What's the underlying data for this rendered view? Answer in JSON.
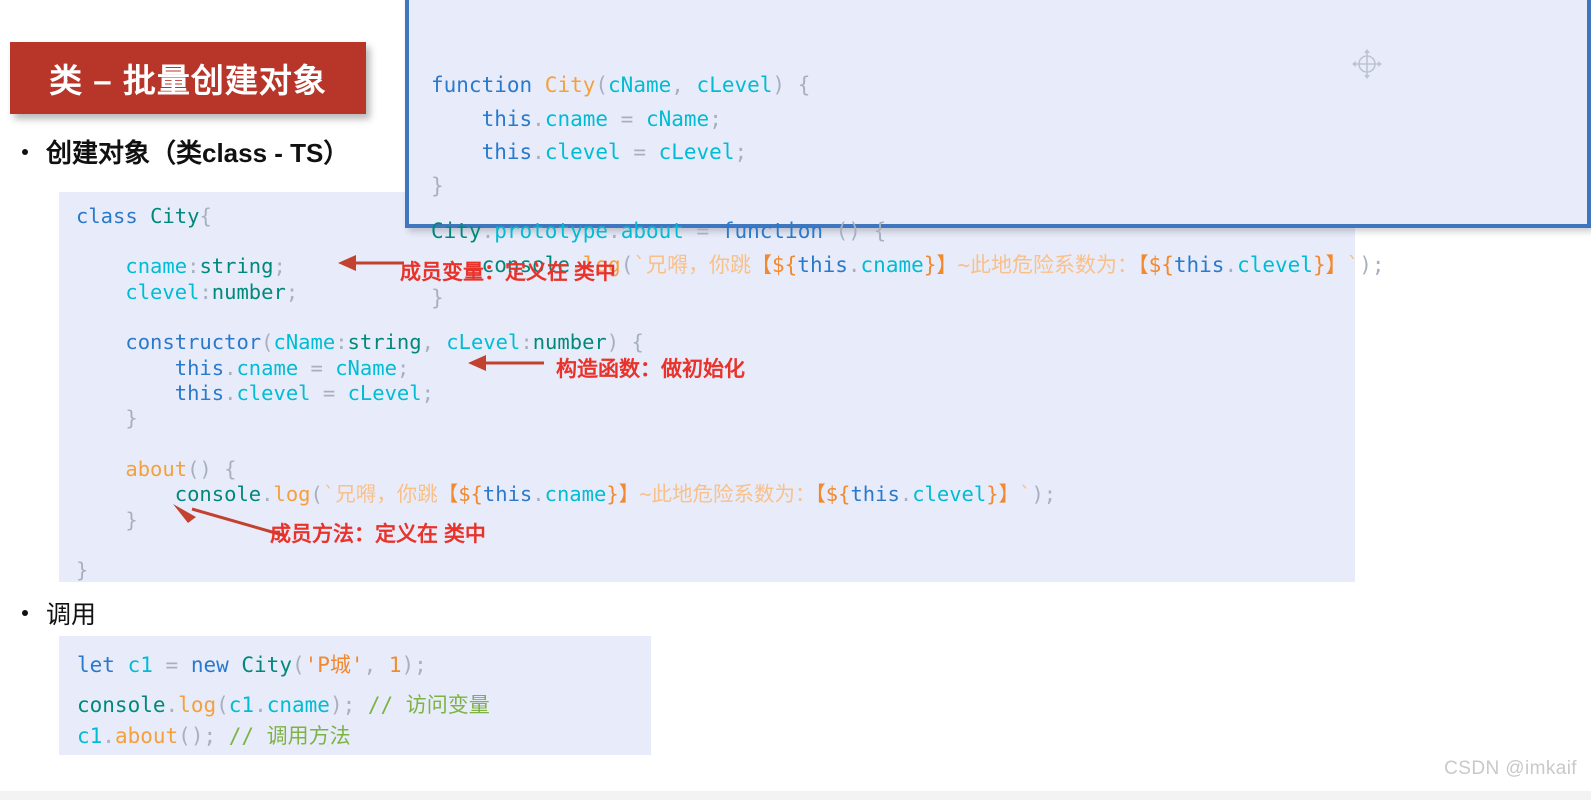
{
  "slide": {
    "title": "类 – 批量创建对象",
    "title_bg": "#B8352A",
    "watermark": "CSDN @imkaif"
  },
  "bullets": {
    "create": "创建对象（类class - TS）",
    "invoke": "调用"
  },
  "code_proto": {
    "lines": [
      [
        {
          "t": "function ",
          "c": "kw"
        },
        {
          "t": "City",
          "c": "fn"
        },
        {
          "t": "(",
          "c": "punct"
        },
        {
          "t": "cName",
          "c": "prop"
        },
        {
          "t": ", ",
          "c": "punct"
        },
        {
          "t": "cLevel",
          "c": "prop"
        },
        {
          "t": ") {",
          "c": "punct"
        }
      ],
      [
        {
          "t": "    ",
          "c": "plain"
        },
        {
          "t": "this",
          "c": "kw"
        },
        {
          "t": ".",
          "c": "punct"
        },
        {
          "t": "cname",
          "c": "prop"
        },
        {
          "t": " = ",
          "c": "punct"
        },
        {
          "t": "cName",
          "c": "prop"
        },
        {
          "t": ";",
          "c": "punct"
        }
      ],
      [
        {
          "t": "    ",
          "c": "plain"
        },
        {
          "t": "this",
          "c": "kw"
        },
        {
          "t": ".",
          "c": "punct"
        },
        {
          "t": "clevel",
          "c": "prop"
        },
        {
          "t": " = ",
          "c": "punct"
        },
        {
          "t": "cLevel",
          "c": "prop"
        },
        {
          "t": ";",
          "c": "punct"
        }
      ],
      [
        {
          "t": "}",
          "c": "punct"
        }
      ],
      [],
      [
        {
          "t": "City",
          "c": "type"
        },
        {
          "t": ".",
          "c": "punct"
        },
        {
          "t": "prototype",
          "c": "prop"
        },
        {
          "t": ".",
          "c": "punct"
        },
        {
          "t": "about",
          "c": "prop"
        },
        {
          "t": " = ",
          "c": "punct"
        },
        {
          "t": "function",
          "c": "kw"
        },
        {
          "t": " () {",
          "c": "punct"
        }
      ],
      [
        {
          "t": "    ",
          "c": "plain"
        },
        {
          "t": "console",
          "c": "type"
        },
        {
          "t": ".",
          "c": "punct"
        },
        {
          "t": "log",
          "c": "fn"
        },
        {
          "t": "(",
          "c": "punct"
        },
        {
          "t": "`兄嘚，你跳",
          "c": "str"
        },
        {
          "t": "【",
          "c": "strong"
        },
        {
          "t": "${",
          "c": "strong"
        },
        {
          "t": "this",
          "c": "kw"
        },
        {
          "t": ".",
          "c": "punct"
        },
        {
          "t": "cname",
          "c": "prop"
        },
        {
          "t": "}",
          "c": "strong"
        },
        {
          "t": "】",
          "c": "strong"
        },
        {
          "t": "~此地危险系数为：",
          "c": "str"
        },
        {
          "t": "【",
          "c": "strong"
        },
        {
          "t": "${",
          "c": "strong"
        },
        {
          "t": "this",
          "c": "kw"
        },
        {
          "t": ".",
          "c": "punct"
        },
        {
          "t": "clevel",
          "c": "prop"
        },
        {
          "t": "}",
          "c": "strong"
        },
        {
          "t": "】",
          "c": "strong"
        },
        {
          "t": "`",
          "c": "str"
        },
        {
          "t": ");",
          "c": "punct"
        }
      ],
      [
        {
          "t": "}",
          "c": "punct"
        }
      ]
    ]
  },
  "code_main": {
    "lines": [
      [
        {
          "t": "class ",
          "c": "kw"
        },
        {
          "t": "City",
          "c": "type"
        },
        {
          "t": "{",
          "c": "punct"
        }
      ],
      [],
      [
        {
          "t": "    ",
          "c": "plain"
        },
        {
          "t": "cname",
          "c": "prop"
        },
        {
          "t": ":",
          "c": "punct"
        },
        {
          "t": "string",
          "c": "type"
        },
        {
          "t": ";",
          "c": "punct"
        }
      ],
      [
        {
          "t": "    ",
          "c": "plain"
        },
        {
          "t": "clevel",
          "c": "prop"
        },
        {
          "t": ":",
          "c": "punct"
        },
        {
          "t": "number",
          "c": "type"
        },
        {
          "t": ";",
          "c": "punct"
        }
      ],
      [],
      [
        {
          "t": "    ",
          "c": "plain"
        },
        {
          "t": "constructor",
          "c": "kw"
        },
        {
          "t": "(",
          "c": "punct"
        },
        {
          "t": "cName",
          "c": "prop"
        },
        {
          "t": ":",
          "c": "punct"
        },
        {
          "t": "string",
          "c": "type"
        },
        {
          "t": ", ",
          "c": "punct"
        },
        {
          "t": "cLevel",
          "c": "prop"
        },
        {
          "t": ":",
          "c": "punct"
        },
        {
          "t": "number",
          "c": "type"
        },
        {
          "t": ") {",
          "c": "punct"
        }
      ],
      [
        {
          "t": "        ",
          "c": "plain"
        },
        {
          "t": "this",
          "c": "kw"
        },
        {
          "t": ".",
          "c": "punct"
        },
        {
          "t": "cname",
          "c": "prop"
        },
        {
          "t": " = ",
          "c": "punct"
        },
        {
          "t": "cName",
          "c": "prop"
        },
        {
          "t": ";",
          "c": "punct"
        }
      ],
      [
        {
          "t": "        ",
          "c": "plain"
        },
        {
          "t": "this",
          "c": "kw"
        },
        {
          "t": ".",
          "c": "punct"
        },
        {
          "t": "clevel",
          "c": "prop"
        },
        {
          "t": " = ",
          "c": "punct"
        },
        {
          "t": "cLevel",
          "c": "prop"
        },
        {
          "t": ";",
          "c": "punct"
        }
      ],
      [
        {
          "t": "    }",
          "c": "punct"
        }
      ],
      [],
      [
        {
          "t": "    ",
          "c": "plain"
        },
        {
          "t": "about",
          "c": "fn"
        },
        {
          "t": "() {",
          "c": "punct"
        }
      ],
      [
        {
          "t": "        ",
          "c": "plain"
        },
        {
          "t": "console",
          "c": "type"
        },
        {
          "t": ".",
          "c": "punct"
        },
        {
          "t": "log",
          "c": "fn"
        },
        {
          "t": "(",
          "c": "punct"
        },
        {
          "t": "`兄嘚，你跳",
          "c": "str"
        },
        {
          "t": "【",
          "c": "strong"
        },
        {
          "t": "${",
          "c": "strong"
        },
        {
          "t": "this",
          "c": "kw"
        },
        {
          "t": ".",
          "c": "punct"
        },
        {
          "t": "cname",
          "c": "prop"
        },
        {
          "t": "}",
          "c": "strong"
        },
        {
          "t": "】",
          "c": "strong"
        },
        {
          "t": "~此地危险系数为：",
          "c": "str"
        },
        {
          "t": "【",
          "c": "strong"
        },
        {
          "t": "${",
          "c": "strong"
        },
        {
          "t": "this",
          "c": "kw"
        },
        {
          "t": ".",
          "c": "punct"
        },
        {
          "t": "clevel",
          "c": "prop"
        },
        {
          "t": "}",
          "c": "strong"
        },
        {
          "t": "】",
          "c": "strong"
        },
        {
          "t": "`",
          "c": "str"
        },
        {
          "t": ");",
          "c": "punct"
        }
      ],
      [
        {
          "t": "    }",
          "c": "punct"
        }
      ],
      [],
      [
        {
          "t": "}",
          "c": "punct"
        }
      ]
    ]
  },
  "code_invoke": {
    "lines": [
      [
        {
          "t": "let ",
          "c": "kw"
        },
        {
          "t": "c1",
          "c": "prop"
        },
        {
          "t": " = ",
          "c": "punct"
        },
        {
          "t": "new ",
          "c": "kw"
        },
        {
          "t": "City",
          "c": "type"
        },
        {
          "t": "(",
          "c": "punct"
        },
        {
          "t": "'P城'",
          "c": "strlit"
        },
        {
          "t": ", ",
          "c": "punct"
        },
        {
          "t": "1",
          "c": "num"
        },
        {
          "t": ");",
          "c": "punct"
        }
      ],
      [],
      [
        {
          "t": "console",
          "c": "type"
        },
        {
          "t": ".",
          "c": "punct"
        },
        {
          "t": "log",
          "c": "fn"
        },
        {
          "t": "(",
          "c": "punct"
        },
        {
          "t": "c1",
          "c": "prop"
        },
        {
          "t": ".",
          "c": "punct"
        },
        {
          "t": "cname",
          "c": "prop"
        },
        {
          "t": "); ",
          "c": "punct"
        },
        {
          "t": "// 访问变量",
          "c": "comment"
        }
      ],
      [
        {
          "t": "c1",
          "c": "prop"
        },
        {
          "t": ".",
          "c": "punct"
        },
        {
          "t": "about",
          "c": "fn"
        },
        {
          "t": "(); ",
          "c": "punct"
        },
        {
          "t": "// 调用方法",
          "c": "comment"
        }
      ]
    ]
  },
  "annotations": {
    "member_variable": "成员变量：定义在 类中",
    "constructor": "构造函数：做初始化",
    "member_method": "成员方法：定义在 类中",
    "color": "#E8322A"
  }
}
